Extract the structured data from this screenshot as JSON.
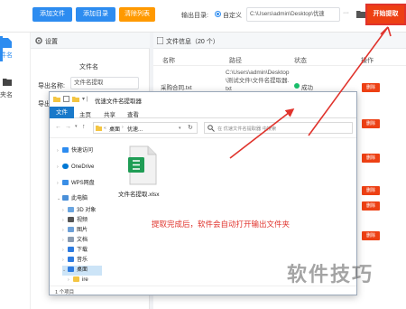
{
  "toolbar": {
    "add_file": "添加文件",
    "add_dir": "添加目录",
    "clear": "清除列表",
    "output_label": "输出目录:",
    "custom": "自定义",
    "path": "C:\\Users\\admin\\Desktop\\优速",
    "more": "···",
    "start": "开始提取"
  },
  "leftnav": {
    "item1": "件名",
    "item2": "夹名"
  },
  "settings": {
    "title": "设置",
    "section": "文件名",
    "export_label": "导出名称:",
    "export_value": "文件名提取",
    "row2_label": "导出"
  },
  "main": {
    "title": "文件信息（20 个）",
    "columns": [
      "名称",
      "路径",
      "状态",
      "操作"
    ],
    "row_name": "采购合同.txt",
    "row_path": "C:\\Users\\admin\\Desktop\\测试文件\\文件名提取器.txt",
    "row_status": "成功",
    "delete": "删除"
  },
  "explorer": {
    "title": "优速文件名提取器",
    "tabs": [
      "文件",
      "主页",
      "共享",
      "查看"
    ],
    "crumb_home": "桌面",
    "crumb_cur": "优速...",
    "search_placeholder": "在 优速文件名提取器 中搜索",
    "nav": [
      "快速访问",
      "OneDrive",
      "WPS网盘",
      "此电脑",
      "3D 对象",
      "视频",
      "图片",
      "文档",
      "下载",
      "音乐",
      "桌面",
      "ire"
    ],
    "file_name": "文件名提取.xlsx",
    "annotation": "提取完成后，软件会自动打开输出文件夹",
    "status": "1 个项目"
  },
  "watermark": "软件技巧",
  "colors": {
    "accent": "#2d8cf0",
    "orange": "#ff9900",
    "red": "#ed4014",
    "annotation": "#e0332c",
    "excel": "#1f9d55"
  }
}
